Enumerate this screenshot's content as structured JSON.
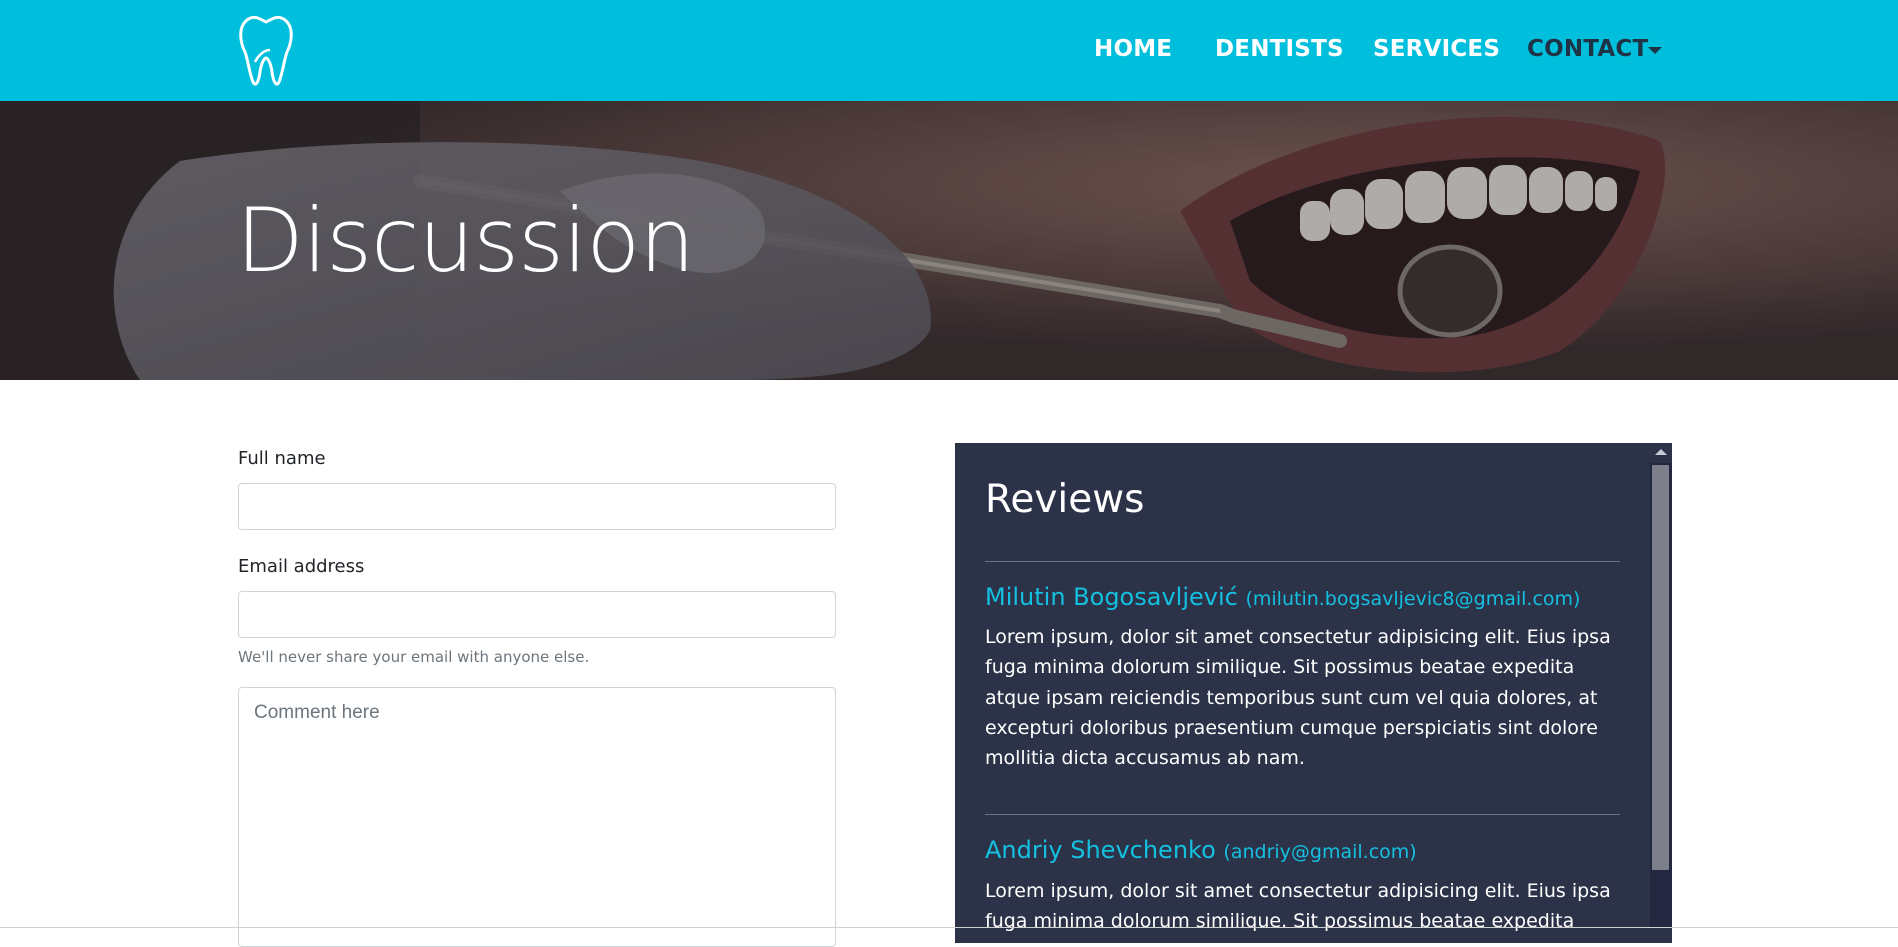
{
  "navbar": {
    "brand_icon": "tooth-icon",
    "items": [
      {
        "label": "HOME"
      },
      {
        "label": "DENTISTS"
      },
      {
        "label": "SERVICES"
      },
      {
        "label": "CONTACT"
      }
    ],
    "colors": {
      "background": "#00bfdc",
      "active": "#1f3347",
      "text": "#ffffff"
    }
  },
  "hero": {
    "title": "Discussion"
  },
  "form": {
    "full_name_label": "Full name",
    "full_name_value": "",
    "email_label": "Email address",
    "email_value": "",
    "email_help": "We'll never share your email with anyone else.",
    "comment_placeholder": "Comment here"
  },
  "reviews": {
    "title": "Reviews",
    "items": [
      {
        "name": "Milutin Bogosavljević",
        "email": "(milutin.bogsavljevic8@gmail.com)",
        "text": "Lorem ipsum, dolor sit amet consectetur adipisicing elit. Eius ipsa fuga minima dolorum similique. Sit possimus beatae expedita atque ipsam reiciendis temporibus sunt cum vel quia dolores, at excepturi doloribus praesentium cumque perspiciatis sint dolore mollitia dicta accusamus ab nam."
      },
      {
        "name": "Andriy Shevchenko",
        "email": "(andriy@gmail.com)",
        "text": "Lorem ipsum, dolor sit amet consectetur adipisicing elit. Eius ipsa fuga minima dolorum similique. Sit possimus beatae expedita atque ipsam"
      }
    ],
    "colors": {
      "panel": "#2c3248",
      "accent": "#14c0e0"
    }
  }
}
